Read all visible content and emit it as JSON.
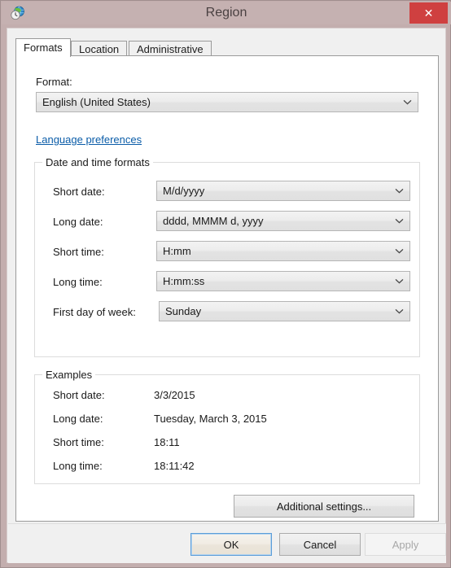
{
  "window": {
    "title": "Region",
    "icon": "region-globe-clock-icon",
    "close_label": "✕",
    "frame_color": "#c3aeae",
    "titlebar_color": "#c5b1b1",
    "close_color": "#cf4040"
  },
  "tabs": [
    {
      "label": "Formats",
      "active": true
    },
    {
      "label": "Location",
      "active": false
    },
    {
      "label": "Administrative",
      "active": false
    }
  ],
  "format_section": {
    "label": "Format:",
    "value": "English (United States)"
  },
  "language_link": {
    "label": "Language preferences",
    "color": "#0a5ca8"
  },
  "datetime_group": {
    "title": "Date and time formats",
    "rows": [
      {
        "label": "Short date:",
        "value": "M/d/yyyy"
      },
      {
        "label": "Long date:",
        "value": "dddd, MMMM d, yyyy"
      },
      {
        "label": "Short time:",
        "value": "H:mm"
      },
      {
        "label": "Long time:",
        "value": "H:mm:ss"
      },
      {
        "label": "First day of week:",
        "value": "Sunday"
      }
    ]
  },
  "examples_group": {
    "title": "Examples",
    "rows": [
      {
        "label": "Short date:",
        "value": "3/3/2015"
      },
      {
        "label": "Long date:",
        "value": "Tuesday, March 3, 2015"
      },
      {
        "label": "Short time:",
        "value": "18:11"
      },
      {
        "label": "Long time:",
        "value": "18:11:42"
      }
    ]
  },
  "additional_settings_button": {
    "label": "Additional settings..."
  },
  "footer_buttons": {
    "ok": "OK",
    "cancel": "Cancel",
    "apply": "Apply"
  }
}
